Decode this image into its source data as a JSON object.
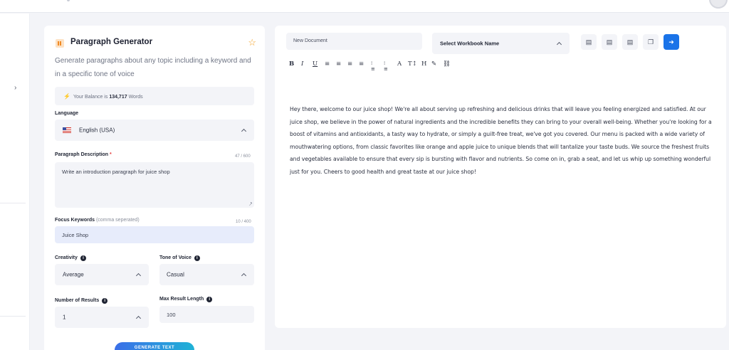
{
  "panel": {
    "title": "Paragraph Generator",
    "description": "Generate paragraphs about any topic including a keyword and in a specific tone of voice",
    "balance_prefix": "Your Balance is ",
    "balance_value": "134,717",
    "balance_suffix": " Words",
    "language_label": "Language",
    "language_value": "English (USA)",
    "description_label": "Paragraph Description",
    "description_required": "*",
    "description_counter": "47 / 600",
    "description_value": "Write an introduction paragraph for juice shop",
    "keywords_label": "Focus Keywords",
    "keywords_hint": " (comma seperated)",
    "keywords_counter": "10 / 400",
    "keywords_value": "Juice Shop",
    "creativity_label": "Creativity",
    "creativity_value": "Average",
    "tone_label": "Tone of Voice",
    "tone_value": "Casual",
    "results_label": "Number of Results",
    "results_value": "1",
    "maxlen_label": "Max Result Length",
    "maxlen_value": "100",
    "generate_label": "GENERATE TEXT"
  },
  "editor": {
    "doc_name_placeholder": "New Document",
    "workbook_label": "Select Workbook Name",
    "toolbar": {
      "bold": "B",
      "italic": "I",
      "underline": "U",
      "align_left": "≡",
      "align_center": "≡",
      "align_right": "≡",
      "align_justify": "≡",
      "ordered_list": "⁝≡",
      "bullet_list": "⁝≡",
      "font_color": "A",
      "font_size": "T↕",
      "heading": "H"
    },
    "content": "Hey there, welcome to our juice shop! We're all about serving up refreshing and delicious drinks that will leave you feeling energized and satisfied. At our juice shop, we believe in the power of natural ingredients and the incredible benefits they can bring to your overall well-being. Whether you're looking for a boost of vitamins and antioxidants, a tasty way to hydrate, or simply a guilt-free treat, we've got you covered. Our menu is packed with a wide variety of mouthwatering options, from classic favorites like orange and apple juice to unique blends that will tantalize your taste buds. We source the freshest fruits and vegetables available to ensure that every sip is bursting with flavor and nutrients. So come on in, grab a seat, and let us whip up something wonderful just for you. Cheers to good health and great taste at our juice shop!"
  },
  "icons": {
    "star": "star-icon",
    "bolt": "bolt-icon",
    "flag": "us-flag-icon",
    "info": "info-icon",
    "chevron": "chevron-up-icon"
  },
  "colors": {
    "accent": "#1a73e8",
    "star": "#f4a023",
    "required": "#e53b3b"
  }
}
